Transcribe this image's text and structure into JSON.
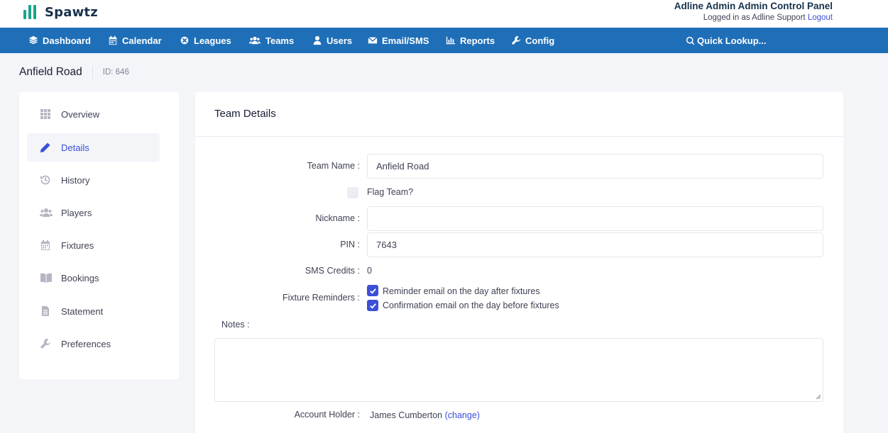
{
  "header": {
    "brand": "Spawtz",
    "panel_title": "Adline Admin Admin Control Panel",
    "logged_in_text": "Logged in as Adline Support",
    "logout_label": "Logout"
  },
  "nav": {
    "dashboard": "Dashboard",
    "calendar": "Calendar",
    "leagues": "Leagues",
    "teams": "Teams",
    "users": "Users",
    "email_sms": "Email/SMS",
    "reports": "Reports",
    "config": "Config",
    "quick_lookup": "Quick Lookup..."
  },
  "page": {
    "title": "Anfield Road",
    "id_label": "ID: 646"
  },
  "sidebar": {
    "items": [
      {
        "label": "Overview",
        "icon": "grid-icon"
      },
      {
        "label": "Details",
        "icon": "pencil-icon",
        "active": true
      },
      {
        "label": "History",
        "icon": "history-icon"
      },
      {
        "label": "Players",
        "icon": "users-icon"
      },
      {
        "label": "Fixtures",
        "icon": "calendar-icon"
      },
      {
        "label": "Bookings",
        "icon": "book-icon"
      },
      {
        "label": "Statement",
        "icon": "document-icon"
      },
      {
        "label": "Preferences",
        "icon": "wrench-icon"
      }
    ]
  },
  "details": {
    "card_title": "Team Details",
    "team_name_label": "Team Name :",
    "team_name_value": "Anfield Road",
    "flag_team_label": "Flag Team?",
    "flag_team_checked": false,
    "nickname_label": "Nickname :",
    "nickname_value": "",
    "pin_label": "PIN :",
    "pin_value": "7643",
    "sms_credits_label": "SMS Credits :",
    "sms_credits_value": "0",
    "fixture_reminders_label": "Fixture Reminders :",
    "reminder_after_label": "Reminder email on the day after fixtures",
    "reminder_after_checked": true,
    "confirmation_before_label": "Confirmation email on the day before fixtures",
    "confirmation_before_checked": true,
    "notes_label": "Notes :",
    "notes_value": "",
    "account_holder_label": "Account Holder :",
    "account_holder_value": "James Cumberton",
    "change_open": "(",
    "change_label": "change",
    "change_close": ")"
  },
  "colors": {
    "nav_bg": "#1f6fb8",
    "accent": "#3b4fd8",
    "brand_green": "#1aa38a",
    "page_bg": "#f4f5f8"
  }
}
